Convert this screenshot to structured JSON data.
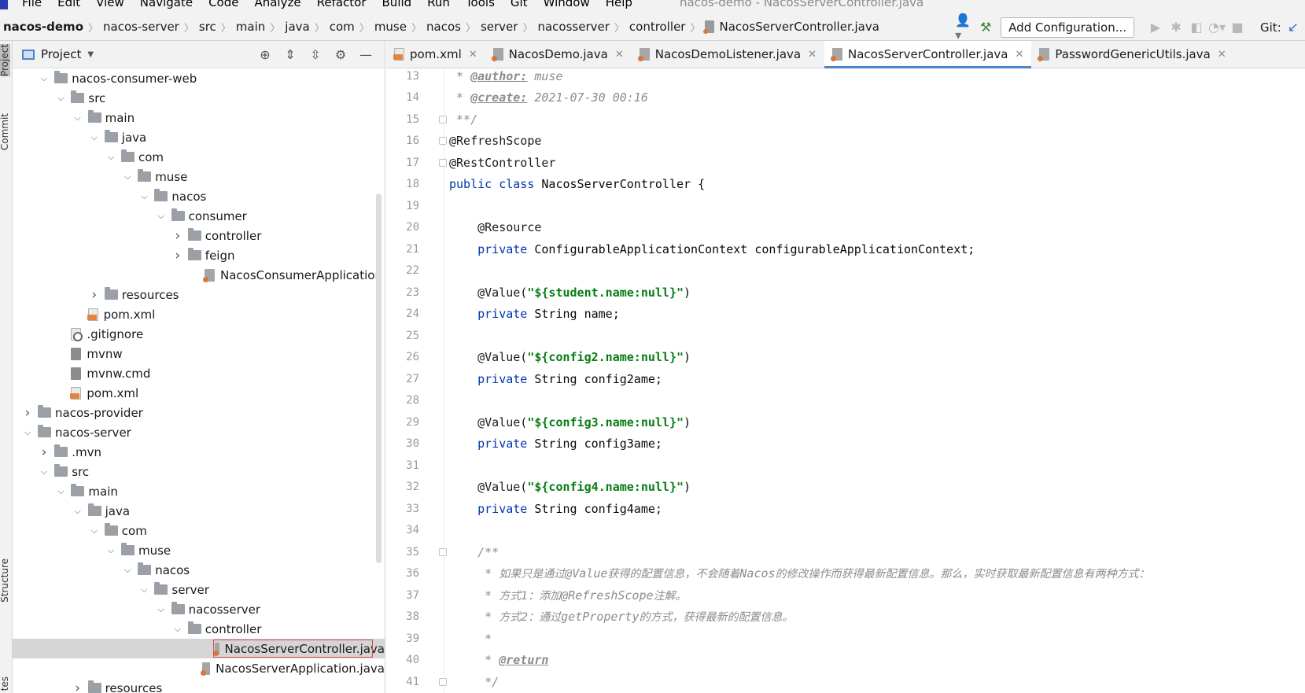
{
  "menu": {
    "items": [
      "File",
      "Edit",
      "View",
      "Navigate",
      "Code",
      "Analyze",
      "Refactor",
      "Build",
      "Run",
      "Tools",
      "Git",
      "Window",
      "Help"
    ],
    "window_title": "nacos-demo - NacosServerController.java"
  },
  "breadcrumb": [
    "nacos-demo",
    "nacos-server",
    "src",
    "main",
    "java",
    "com",
    "muse",
    "nacos",
    "server",
    "nacosserver",
    "controller",
    "NacosServerController.java"
  ],
  "toolbar": {
    "add_config_label": "Add Configuration...",
    "git_label": "Git:"
  },
  "left_strip": {
    "project_tab": "Project",
    "commit_tab": "Commit",
    "structure_tab": "Structure",
    "favorites_tab": "tes"
  },
  "project_panel": {
    "title": "Project",
    "tree": [
      {
        "label": "nacos-consumer-web",
        "depth": 2,
        "type": "folder",
        "chev": "open"
      },
      {
        "label": "src",
        "depth": 3,
        "type": "folder",
        "chev": "open"
      },
      {
        "label": "main",
        "depth": 4,
        "type": "folder",
        "chev": "open"
      },
      {
        "label": "java",
        "depth": 5,
        "type": "folder",
        "chev": "open"
      },
      {
        "label": "com",
        "depth": 6,
        "type": "folder",
        "chev": "open"
      },
      {
        "label": "muse",
        "depth": 7,
        "type": "folder",
        "chev": "open"
      },
      {
        "label": "nacos",
        "depth": 8,
        "type": "folder",
        "chev": "open"
      },
      {
        "label": "consumer",
        "depth": 9,
        "type": "folder",
        "chev": "open"
      },
      {
        "label": "controller",
        "depth": 10,
        "type": "folder",
        "chev": "closed"
      },
      {
        "label": "feign",
        "depth": 10,
        "type": "folder",
        "chev": "closed"
      },
      {
        "label": "NacosConsumerApplication",
        "depth": 11,
        "type": "java",
        "chev": "none"
      },
      {
        "label": "resources",
        "depth": 5,
        "type": "folder",
        "chev": "closed"
      },
      {
        "label": "pom.xml",
        "depth": 4,
        "type": "xml",
        "chev": "none"
      },
      {
        "label": ".gitignore",
        "depth": 3,
        "type": "git",
        "chev": "none"
      },
      {
        "label": "mvnw",
        "depth": 3,
        "type": "shell",
        "chev": "none"
      },
      {
        "label": "mvnw.cmd",
        "depth": 3,
        "type": "cmd",
        "chev": "none"
      },
      {
        "label": "pom.xml",
        "depth": 3,
        "type": "xml",
        "chev": "none"
      },
      {
        "label": "nacos-provider",
        "depth": 1,
        "type": "folder",
        "chev": "closed"
      },
      {
        "label": "nacos-server",
        "depth": 1,
        "type": "folder",
        "chev": "open"
      },
      {
        "label": ".mvn",
        "depth": 2,
        "type": "folder",
        "chev": "closed"
      },
      {
        "label": "src",
        "depth": 2,
        "type": "folder",
        "chev": "open"
      },
      {
        "label": "main",
        "depth": 3,
        "type": "folder",
        "chev": "open"
      },
      {
        "label": "java",
        "depth": 4,
        "type": "folder",
        "chev": "open"
      },
      {
        "label": "com",
        "depth": 5,
        "type": "folder",
        "chev": "open"
      },
      {
        "label": "muse",
        "depth": 6,
        "type": "folder",
        "chev": "open"
      },
      {
        "label": "nacos",
        "depth": 7,
        "type": "folder",
        "chev": "open"
      },
      {
        "label": "server",
        "depth": 8,
        "type": "folder",
        "chev": "open"
      },
      {
        "label": "nacosserver",
        "depth": 9,
        "type": "folder",
        "chev": "open"
      },
      {
        "label": "controller",
        "depth": 10,
        "type": "folder",
        "chev": "open"
      },
      {
        "label": "NacosServerController.java",
        "depth": 12,
        "type": "java",
        "chev": "none",
        "selected": true
      },
      {
        "label": "NacosServerApplication.java",
        "depth": 11,
        "type": "java",
        "chev": "none"
      },
      {
        "label": "resources",
        "depth": 4,
        "type": "folder",
        "chev": "closed"
      }
    ]
  },
  "tabs": [
    {
      "label": "pom.xml",
      "type": "xml"
    },
    {
      "label": "NacosDemo.java",
      "type": "java"
    },
    {
      "label": "NacosDemoListener.java",
      "type": "java"
    },
    {
      "label": "NacosServerController.java",
      "type": "java",
      "active": true
    },
    {
      "label": "PasswordGenericUtils.java",
      "type": "java"
    }
  ],
  "code": {
    "lines": [
      {
        "n": "13",
        "segs": [
          [
            " * ",
            "cmt"
          ],
          [
            "@author:",
            "doctag"
          ],
          [
            " muse",
            "cmt"
          ]
        ]
      },
      {
        "n": "14",
        "segs": [
          [
            " * ",
            "cmt"
          ],
          [
            "@create:",
            "doctag"
          ],
          [
            " 2021-07-30 00:16",
            "cmt"
          ]
        ]
      },
      {
        "n": "15",
        "segs": [
          [
            " **/",
            "cmt"
          ]
        ],
        "fold": true
      },
      {
        "n": "16",
        "segs": [
          [
            "@RefreshScope",
            "ann"
          ]
        ],
        "fold": true
      },
      {
        "n": "17",
        "segs": [
          [
            "@RestController",
            "ann"
          ]
        ],
        "fold": true
      },
      {
        "n": "18",
        "segs": [
          [
            "public class ",
            "kw"
          ],
          [
            "NacosServerController {",
            ""
          ]
        ]
      },
      {
        "n": "19",
        "segs": []
      },
      {
        "n": "20",
        "segs": [
          [
            "    @Resource",
            "ann"
          ]
        ]
      },
      {
        "n": "21",
        "segs": [
          [
            "    private ",
            "kw"
          ],
          [
            "ConfigurableApplicationContext configurableApplicationContext;",
            ""
          ]
        ]
      },
      {
        "n": "22",
        "segs": []
      },
      {
        "n": "23",
        "segs": [
          [
            "    @Value(",
            "ann"
          ],
          [
            "\"${student.name:null}\"",
            "str"
          ],
          [
            ")",
            ""
          ]
        ]
      },
      {
        "n": "24",
        "segs": [
          [
            "    private ",
            "kw"
          ],
          [
            "String name;",
            ""
          ]
        ]
      },
      {
        "n": "25",
        "segs": []
      },
      {
        "n": "26",
        "segs": [
          [
            "    @Value(",
            "ann"
          ],
          [
            "\"${config2.name:null}\"",
            "str"
          ],
          [
            ")",
            ""
          ]
        ]
      },
      {
        "n": "27",
        "segs": [
          [
            "    private ",
            "kw"
          ],
          [
            "String config2ame;",
            ""
          ]
        ]
      },
      {
        "n": "28",
        "segs": []
      },
      {
        "n": "29",
        "segs": [
          [
            "    @Value(",
            "ann"
          ],
          [
            "\"${config3.name:null}\"",
            "str"
          ],
          [
            ")",
            ""
          ]
        ]
      },
      {
        "n": "30",
        "segs": [
          [
            "    private ",
            "kw"
          ],
          [
            "String config3ame;",
            ""
          ]
        ]
      },
      {
        "n": "31",
        "segs": []
      },
      {
        "n": "32",
        "segs": [
          [
            "    @Value(",
            "ann"
          ],
          [
            "\"${config4.name:null}\"",
            "str"
          ],
          [
            ")",
            ""
          ]
        ]
      },
      {
        "n": "33",
        "segs": [
          [
            "    private ",
            "kw"
          ],
          [
            "String config4ame;",
            ""
          ]
        ]
      },
      {
        "n": "34",
        "segs": []
      },
      {
        "n": "35",
        "segs": [
          [
            "    /**",
            "cmt"
          ]
        ],
        "fold": true
      },
      {
        "n": "36",
        "segs": [
          [
            "     * ",
            "cmt"
          ],
          [
            "如果只是通过",
            "cn"
          ],
          [
            "@Value",
            "cmt"
          ],
          [
            "获得的配置信息，不会随着",
            "cn"
          ],
          [
            "Nacos",
            "cmt"
          ],
          [
            "的修改操作而获得最新配置信息。那么，实时获取最新配置信息有两种方式：",
            "cn"
          ]
        ]
      },
      {
        "n": "37",
        "segs": [
          [
            "     * ",
            "cmt"
          ],
          [
            "方式1：添加",
            "cn"
          ],
          [
            "@RefreshScope",
            "cmt"
          ],
          [
            "注解。",
            "cn"
          ]
        ]
      },
      {
        "n": "38",
        "segs": [
          [
            "     * ",
            "cmt"
          ],
          [
            "方式2：通过",
            "cn"
          ],
          [
            "getProperty",
            "cmt"
          ],
          [
            "的方式，获得最新的配置信息。",
            "cn"
          ]
        ]
      },
      {
        "n": "39",
        "segs": [
          [
            "     *",
            "cmt"
          ]
        ]
      },
      {
        "n": "40",
        "segs": [
          [
            "     * ",
            "cmt"
          ],
          [
            "@return",
            "doctag"
          ]
        ]
      },
      {
        "n": "41",
        "segs": [
          [
            "     */",
            "cmt"
          ]
        ],
        "fold": true
      }
    ]
  },
  "colors": {
    "keyword": "#0033b3",
    "string": "#067d17",
    "comment": "#8c8c8c",
    "tab_underline": "#4a87c7",
    "selection": "#d5d5d5"
  }
}
